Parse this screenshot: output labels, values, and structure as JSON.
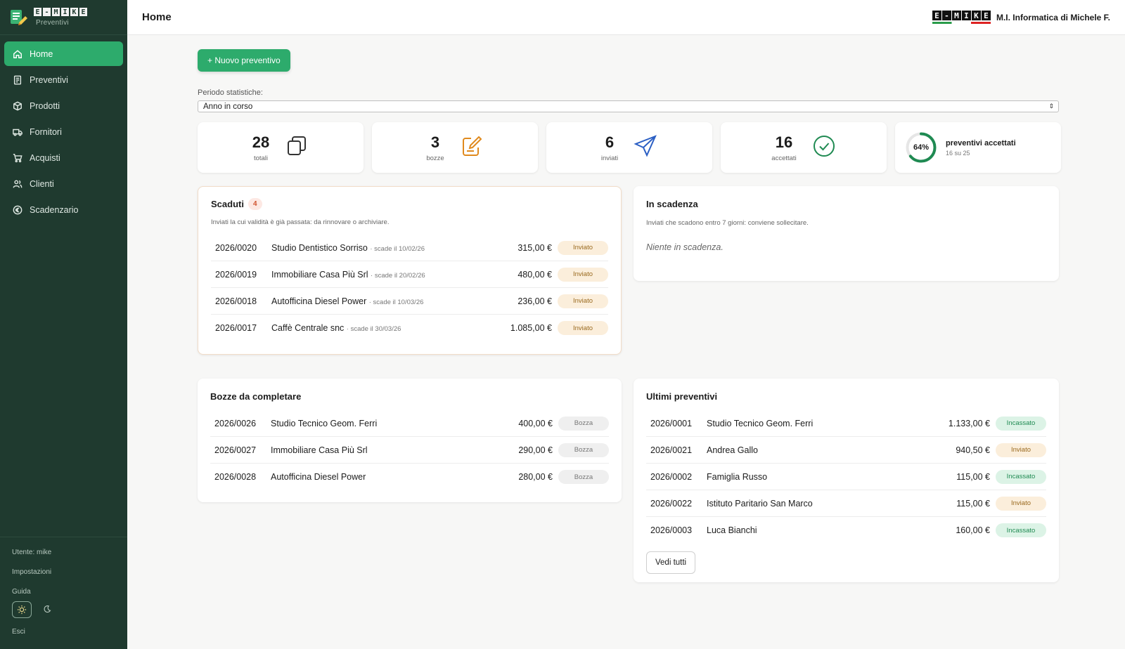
{
  "brand": {
    "logo_letters": [
      "E",
      "-",
      "M",
      "I",
      "K",
      "E"
    ],
    "subtitle": "Preventivi"
  },
  "sidebar": {
    "items": [
      {
        "label": "Home",
        "icon": "home-icon"
      },
      {
        "label": "Preventivi",
        "icon": "document-icon"
      },
      {
        "label": "Prodotti",
        "icon": "box-icon"
      },
      {
        "label": "Fornitori",
        "icon": "truck-icon"
      },
      {
        "label": "Acquisti",
        "icon": "cart-icon"
      },
      {
        "label": "Clienti",
        "icon": "users-icon"
      },
      {
        "label": "Scadenzario",
        "icon": "euro-icon"
      }
    ],
    "user": "Utente: mike",
    "settings": "Impostazioni",
    "guide": "Guida",
    "logout": "Esci"
  },
  "header": {
    "title": "Home",
    "company_logo_letters": [
      "E",
      "-",
      "M",
      "I",
      "K",
      "E"
    ],
    "company_name": "M.I. Informatica di Michele F."
  },
  "main": {
    "new_button": "+ Nuovo preventivo",
    "period_label": "Periodo statistiche:",
    "period_value": "Anno in corso"
  },
  "stats": [
    {
      "value": "28",
      "label": "totali",
      "icon": "copy-icon",
      "color": "#333333"
    },
    {
      "value": "3",
      "label": "bozze",
      "icon": "edit-icon",
      "color": "#e08a1e"
    },
    {
      "value": "6",
      "label": "inviati",
      "icon": "send-icon",
      "color": "#2b5fc4"
    },
    {
      "value": "16",
      "label": "accettati",
      "icon": "check-circle-icon",
      "color": "#1f8a52"
    }
  ],
  "acceptance": {
    "percent_text": "64%",
    "fraction": 0.64,
    "title": "preventivi accettati",
    "sub": "16 su 25",
    "color": "#1f8a52"
  },
  "expired": {
    "title": "Scaduti",
    "count": "4",
    "desc": "Inviati la cui validità è già passata: da rinnovare o archiviare.",
    "rows": [
      {
        "code": "2026/0020",
        "name": "Studio Dentistico Sorriso",
        "due": "· scade il 10/02/26",
        "amount": "315,00 €",
        "status": "Inviato"
      },
      {
        "code": "2026/0019",
        "name": "Immobiliare Casa Più Srl",
        "due": "· scade il 20/02/26",
        "amount": "480,00 €",
        "status": "Inviato"
      },
      {
        "code": "2026/0018",
        "name": "Autofficina Diesel Power",
        "due": "· scade il 10/03/26",
        "amount": "236,00 €",
        "status": "Inviato"
      },
      {
        "code": "2026/0017",
        "name": "Caffè Centrale snc",
        "due": "· scade il 30/03/26",
        "amount": "1.085,00 €",
        "status": "Inviato"
      }
    ]
  },
  "expiring": {
    "title": "In scadenza",
    "desc": "Inviati che scadono entro 7 giorni: conviene sollecitare.",
    "empty": "Niente in scadenza."
  },
  "drafts": {
    "title": "Bozze da completare",
    "rows": [
      {
        "code": "2026/0026",
        "name": "Studio Tecnico Geom. Ferri",
        "amount": "400,00 €",
        "status": "Bozza"
      },
      {
        "code": "2026/0027",
        "name": "Immobiliare Casa Più Srl",
        "amount": "290,00 €",
        "status": "Bozza"
      },
      {
        "code": "2026/0028",
        "name": "Autofficina Diesel Power",
        "amount": "280,00 €",
        "status": "Bozza"
      }
    ]
  },
  "recent": {
    "title": "Ultimi preventivi",
    "rows": [
      {
        "code": "2026/0001",
        "name": "Studio Tecnico Geom. Ferri",
        "amount": "1.133,00 €",
        "status": "Incassato"
      },
      {
        "code": "2026/0021",
        "name": "Andrea Gallo",
        "amount": "940,50 €",
        "status": "Inviato"
      },
      {
        "code": "2026/0002",
        "name": "Famiglia Russo",
        "amount": "115,00 €",
        "status": "Incassato"
      },
      {
        "code": "2026/0022",
        "name": "Istituto Paritario San Marco",
        "amount": "115,00 €",
        "status": "Inviato"
      },
      {
        "code": "2026/0003",
        "name": "Luca Bianchi",
        "amount": "160,00 €",
        "status": "Incassato"
      }
    ],
    "see_all": "Vedi tutti"
  }
}
